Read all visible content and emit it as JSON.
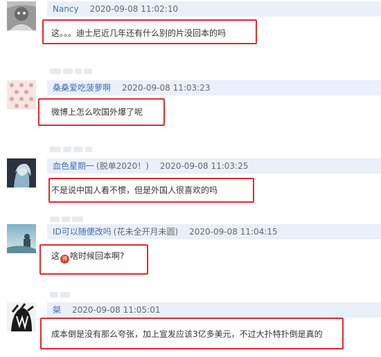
{
  "comments": [
    {
      "username": "Nancy",
      "remark": "",
      "time": "2020-09-08 11:02:10",
      "text": "这。。。迪士尼近几年还有什么别的片没回本的吗"
    },
    {
      "username": "桑桑爱吃菠萝啊",
      "remark": "",
      "time": "2020-09-08 11:03:23",
      "text": "微博上怎么吹国外爆了呢"
    },
    {
      "username": "血色星期一",
      "remark": "(脱单2020！)",
      "time": "2020-09-08 11:03:25",
      "text": "不是说中国人看不惯，但是外国人很喜欢的吗"
    },
    {
      "username": "ID可以随便改吗",
      "remark": "(花未全开月未圆)",
      "time": "2020-09-08 11:04:15",
      "text_before": "这",
      "emoji_label": "得",
      "text_after": "啥时候回本啊?"
    },
    {
      "username": "桀",
      "remark": "",
      "time": "2020-09-08 11:05:01",
      "text": "成本倒是没有那么夸张，加上宣发应该3亿多美元，不过大扑特扑倒是真的"
    }
  ],
  "colors": {
    "username": "#3f6cb4",
    "header_bg": "#eaf0fa",
    "highlight_box": "#e5282e"
  }
}
